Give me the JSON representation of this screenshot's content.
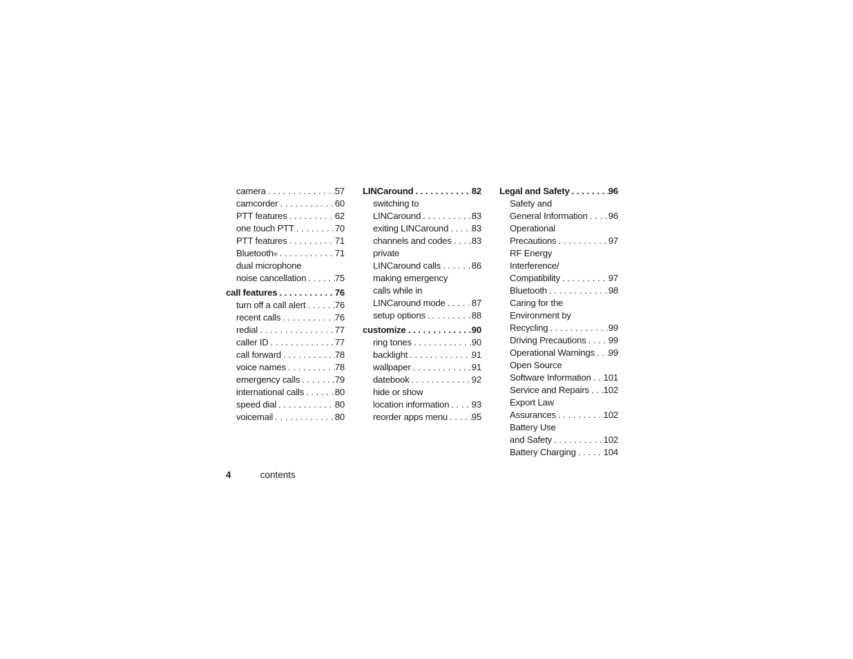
{
  "columns": [
    {
      "entries": [
        {
          "type": "sub",
          "label": "camera",
          "page": "57"
        },
        {
          "type": "sub",
          "label": "camcorder",
          "page": "60"
        },
        {
          "type": "sub",
          "label": "PTT features",
          "page": "62"
        },
        {
          "type": "sub",
          "label": "one touch PTT",
          "page": "70"
        },
        {
          "type": "sub",
          "label": "PTT features",
          "page": "71"
        },
        {
          "type": "sub",
          "label": "Bluetooth",
          "sup": "®",
          "page": "71"
        },
        {
          "type": "sub",
          "label": "dual microphone",
          "page": ""
        },
        {
          "type": "sub",
          "label": "noise cancellation",
          "page": "75"
        },
        {
          "type": "head",
          "label": "call features",
          "page": "76"
        },
        {
          "type": "sub",
          "label": "turn off a call alert",
          "page": "76"
        },
        {
          "type": "sub",
          "label": "recent calls",
          "page": "76"
        },
        {
          "type": "sub",
          "label": "redial",
          "page": "77"
        },
        {
          "type": "sub",
          "label": "caller ID",
          "page": "77"
        },
        {
          "type": "sub",
          "label": "call forward",
          "page": "78"
        },
        {
          "type": "sub",
          "label": "voice names",
          "page": "78"
        },
        {
          "type": "sub",
          "label": "emergency calls",
          "page": "79"
        },
        {
          "type": "sub",
          "label": "international calls",
          "page": "80"
        },
        {
          "type": "sub",
          "label": "speed dial",
          "page": "80"
        },
        {
          "type": "sub",
          "label": "voicemail",
          "page": "80"
        }
      ]
    },
    {
      "entries": [
        {
          "type": "head",
          "label": "LINCaround",
          "page": "82"
        },
        {
          "type": "sub",
          "label": "switching to",
          "page": ""
        },
        {
          "type": "sub",
          "label": "LINCaround",
          "page": "83"
        },
        {
          "type": "sub",
          "label": "exiting LINCaround",
          "page": "83"
        },
        {
          "type": "sub",
          "label": "channels and codes",
          "page": "83"
        },
        {
          "type": "sub",
          "label": "private",
          "page": ""
        },
        {
          "type": "sub",
          "label": "LINCaround calls",
          "page": "86"
        },
        {
          "type": "sub",
          "label": "making emergency",
          "page": ""
        },
        {
          "type": "sub",
          "label": "calls while in",
          "page": ""
        },
        {
          "type": "sub",
          "label": "LINCaround mode",
          "page": "87"
        },
        {
          "type": "sub",
          "label": "setup options",
          "page": "88"
        },
        {
          "type": "head",
          "label": "customize",
          "page": "90"
        },
        {
          "type": "sub",
          "label": "ring tones",
          "page": "90"
        },
        {
          "type": "sub",
          "label": "backlight",
          "page": "91"
        },
        {
          "type": "sub",
          "label": "wallpaper",
          "page": "91"
        },
        {
          "type": "sub",
          "label": "datebook",
          "page": "92"
        },
        {
          "type": "sub",
          "label": "hide or show",
          "page": ""
        },
        {
          "type": "sub",
          "label": "location information",
          "page": "93"
        },
        {
          "type": "sub",
          "label": "reorder apps menu",
          "page": "95"
        }
      ]
    },
    {
      "entries": [
        {
          "type": "head",
          "label": "Legal and Safety",
          "page": "96"
        },
        {
          "type": "sub",
          "label": "Safety and",
          "page": ""
        },
        {
          "type": "sub",
          "label": "General Information",
          "page": "96"
        },
        {
          "type": "sub",
          "label": "Operational",
          "page": ""
        },
        {
          "type": "sub",
          "label": "Precautions",
          "page": "97"
        },
        {
          "type": "sub",
          "label": "RF Energy",
          "page": ""
        },
        {
          "type": "sub",
          "label": "Interference/",
          "page": ""
        },
        {
          "type": "sub",
          "label": "Compatibility",
          "page": "97"
        },
        {
          "type": "sub",
          "label": "Bluetooth",
          "page": "98"
        },
        {
          "type": "sub",
          "label": "Caring for the",
          "page": ""
        },
        {
          "type": "sub",
          "label": "Environment by",
          "page": ""
        },
        {
          "type": "sub",
          "label": "Recycling",
          "page": "99"
        },
        {
          "type": "sub",
          "label": "Driving Precautions",
          "page": "99"
        },
        {
          "type": "sub",
          "label": "Operational Warnings",
          "page": "99"
        },
        {
          "type": "sub",
          "label": "Open Source",
          "page": ""
        },
        {
          "type": "sub",
          "label": "Software Information",
          "page": "101"
        },
        {
          "type": "sub",
          "label": "Service and Repairs",
          "page": "102"
        },
        {
          "type": "sub",
          "label": "Export Law",
          "page": ""
        },
        {
          "type": "sub",
          "label": "Assurances",
          "page": "102"
        },
        {
          "type": "sub",
          "label": "Battery Use",
          "page": ""
        },
        {
          "type": "sub",
          "label": "and Safety",
          "page": "102"
        },
        {
          "type": "sub",
          "label": "Battery Charging",
          "page": "104"
        }
      ]
    }
  ],
  "footer": {
    "page_number": "4",
    "section": "contents"
  }
}
